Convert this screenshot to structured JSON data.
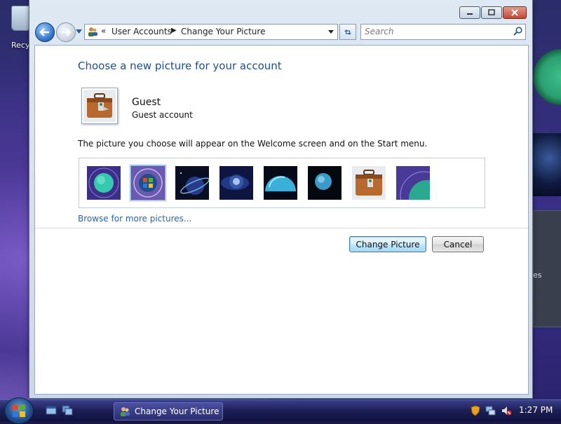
{
  "desktop": {
    "recycle_label": "Recyc",
    "gadget_text": "es"
  },
  "window": {
    "nav": {
      "breadcrumb_chevron": "«",
      "breadcrumb": [
        "User Accounts",
        "Change Your Picture"
      ],
      "search_placeholder": "Search"
    },
    "content": {
      "heading": "Choose a new picture for your account",
      "user": {
        "name": "Guest",
        "account_type": "Guest account"
      },
      "description": "The picture you choose will appear on the Welcome screen and on the Start menu.",
      "pictures": [
        {
          "name": "Teal Planet"
        },
        {
          "name": "Windows Logo",
          "selected": true
        },
        {
          "name": "Ringed Planet"
        },
        {
          "name": "Blue Nebula"
        },
        {
          "name": "Teal Dome"
        },
        {
          "name": "Dark Orb"
        },
        {
          "name": "Suitcase"
        },
        {
          "name": "Purple Arc"
        }
      ],
      "browse_link": "Browse for more pictures...",
      "buttons": {
        "change": "Change Picture",
        "cancel": "Cancel"
      }
    }
  },
  "taskbar": {
    "task_label": "Change Your Picture",
    "clock": "1:27 PM"
  },
  "colors": {
    "heading": "#1e4f8c",
    "link": "#1f66b0",
    "taskbar": "#1c1f55"
  }
}
